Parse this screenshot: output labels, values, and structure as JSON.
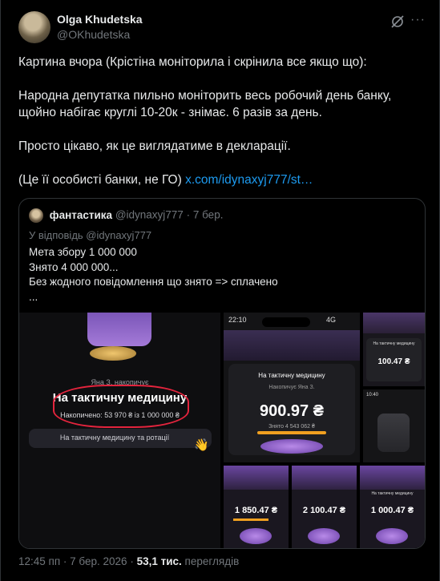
{
  "author": {
    "name": "Olga Khudetska",
    "handle": "@OKhudetska"
  },
  "tweet": {
    "paragraphs": [
      "Картина вчора (Крістіна моніторила і скрінила все якщо що):",
      "Народна депутатка пильно моніторить весь робочий день банку, щойно набігає круглі 10-20к - знімає. 6 разів за день.",
      "Просто цікаво, як це виглядатиме в декларації."
    ],
    "last_text": "(Це її особисті банки, не ГО) ",
    "link": "x.com/idynaxyj777/st…"
  },
  "quote": {
    "name": "фантастика",
    "handle": "@idynaxyj777",
    "date": "7 бер.",
    "separator": " · ",
    "reply_to": "У відповідь @idynaxyj777",
    "lines": [
      "Мета збору 1 000 000",
      "Знято 4 000 000...",
      "Без жодного повідомлення що знято => сплачено",
      "..."
    ]
  },
  "images": {
    "left": {
      "owner": "Яна З. накопичує",
      "title": "На тактичну медицину",
      "saved": "Накопичено: 53 970 ₴ із 1 000 000 ₴",
      "bar_label": "На тактичну медицину та ротації",
      "emoji": "👋"
    },
    "phone": {
      "time": "22:10",
      "signal": "4G",
      "title": "На тактичну медицину",
      "owner": "Накопичує Яна З.",
      "amount": "900.97 ₴",
      "withdrawn": "Знято 4 543 062 ₴"
    },
    "tiles": {
      "t1_title": "На тактичну медицину",
      "t1_amount": "100.47 ₴",
      "t2_time": "10:40",
      "t3_amount": "1 850.47 ₴",
      "t4_amount": "2 100.47 ₴",
      "t5_title": "На тактичну медицину",
      "t5_amount": "1 000.47 ₴"
    }
  },
  "footer": {
    "time": "12:45 пп",
    "date": "7 бер. 2026",
    "views": "53,1 тис.",
    "views_label": "переглядів"
  },
  "colors": {
    "accent": "#1d9bf0",
    "annotation": "#e3243d",
    "card": "#1a1a1e",
    "purple": "#9b6bd6"
  }
}
